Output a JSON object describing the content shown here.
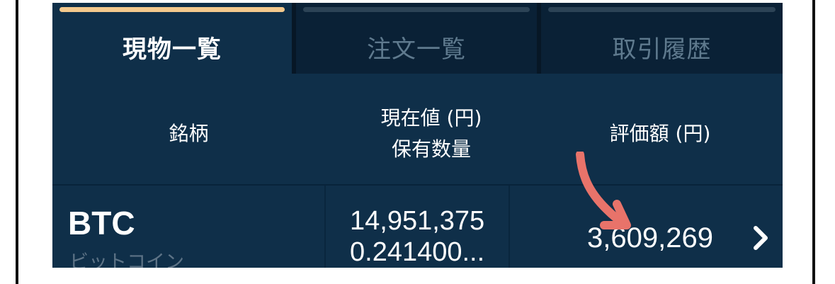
{
  "tabs": [
    {
      "label": "現物一覧",
      "active": true
    },
    {
      "label": "注文一覧",
      "active": false
    },
    {
      "label": "取引履歴",
      "active": false
    }
  ],
  "header": {
    "symbol": "銘柄",
    "price_line1": "現在値 (円)",
    "price_line2": "保有数量",
    "value": "評価額 (円)"
  },
  "row": {
    "symbol": "BTC",
    "name": "ビットコイン",
    "price": "14,951,375",
    "quantity": "0.241400...",
    "value": "3,609,269"
  },
  "colors": {
    "background": "#0f2f49",
    "tab_bar_active": "#f4c98d",
    "annotation_arrow": "#e8736a"
  },
  "icons": {
    "chevron": "chevron-right-icon",
    "annotation": "hand-drawn-arrow-icon"
  }
}
